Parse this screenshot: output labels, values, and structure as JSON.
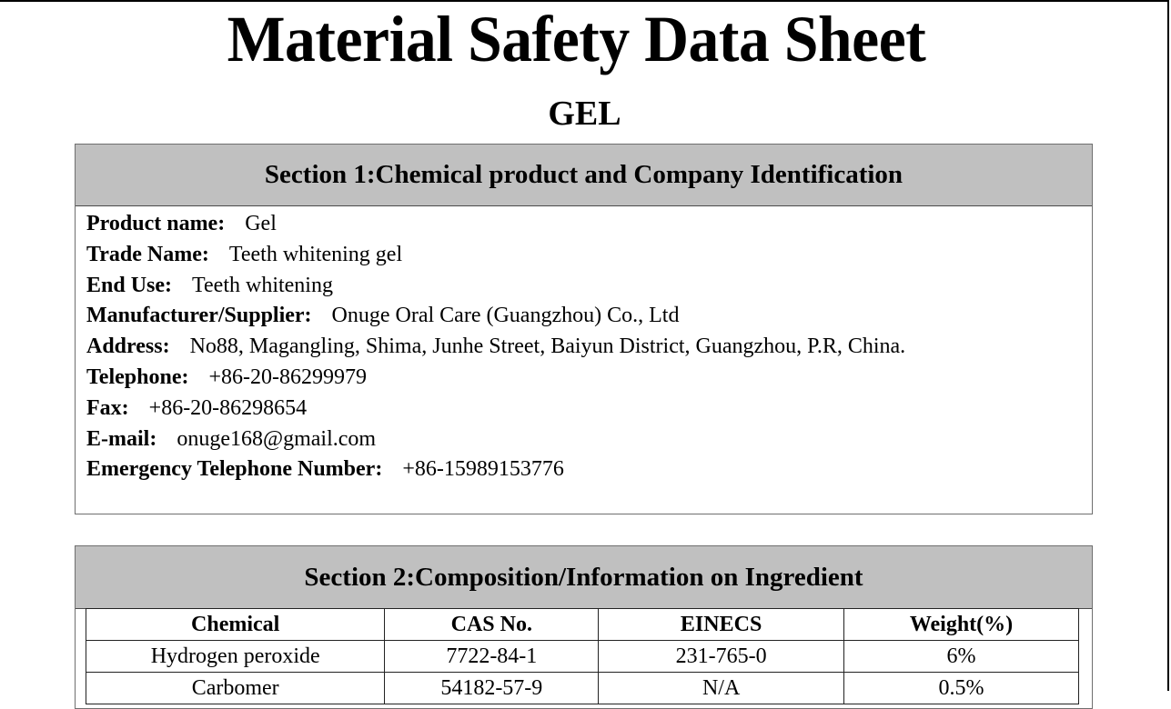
{
  "document": {
    "title": "Material Safety Data Sheet",
    "subtitle": "GEL"
  },
  "section1": {
    "heading": "Section 1:Chemical product and Company Identification",
    "fields": [
      {
        "label": "Product name:",
        "value": "Gel"
      },
      {
        "label": "Trade Name:",
        "value": "Teeth whitening gel"
      },
      {
        "label": "End Use:",
        "value": "Teeth whitening"
      },
      {
        "label": "Manufacturer/Supplier:",
        "value": "Onuge Oral Care (Guangzhou) Co., Ltd"
      },
      {
        "label": "Address:",
        "value": "No88, Magangling, Shima, Junhe Street, Baiyun District, Guangzhou, P.R, China."
      },
      {
        "label": "Telephone:",
        "value": "+86-20-86299979"
      },
      {
        "label": "Fax:",
        "value": "+86-20-86298654"
      },
      {
        "label": "E-mail:",
        "value": "onuge168@gmail.com"
      },
      {
        "label": "Emergency Telephone Number:",
        "value": "+86-15989153776"
      }
    ]
  },
  "section2": {
    "heading": "Section 2:Composition/Information on Ingredient",
    "columns": [
      "Chemical",
      "CAS No.",
      "EINECS",
      "Weight(%)"
    ],
    "rows": [
      [
        "Hydrogen peroxide",
        "7722-84-1",
        "231-765-0",
        "6%"
      ],
      [
        "Carbomer",
        "54182-57-9",
        "N/A",
        "0.5%"
      ]
    ]
  },
  "colors": {
    "section_header_bg": "#c0c0c0",
    "border": "#6f6f6f",
    "text": "#000000"
  }
}
